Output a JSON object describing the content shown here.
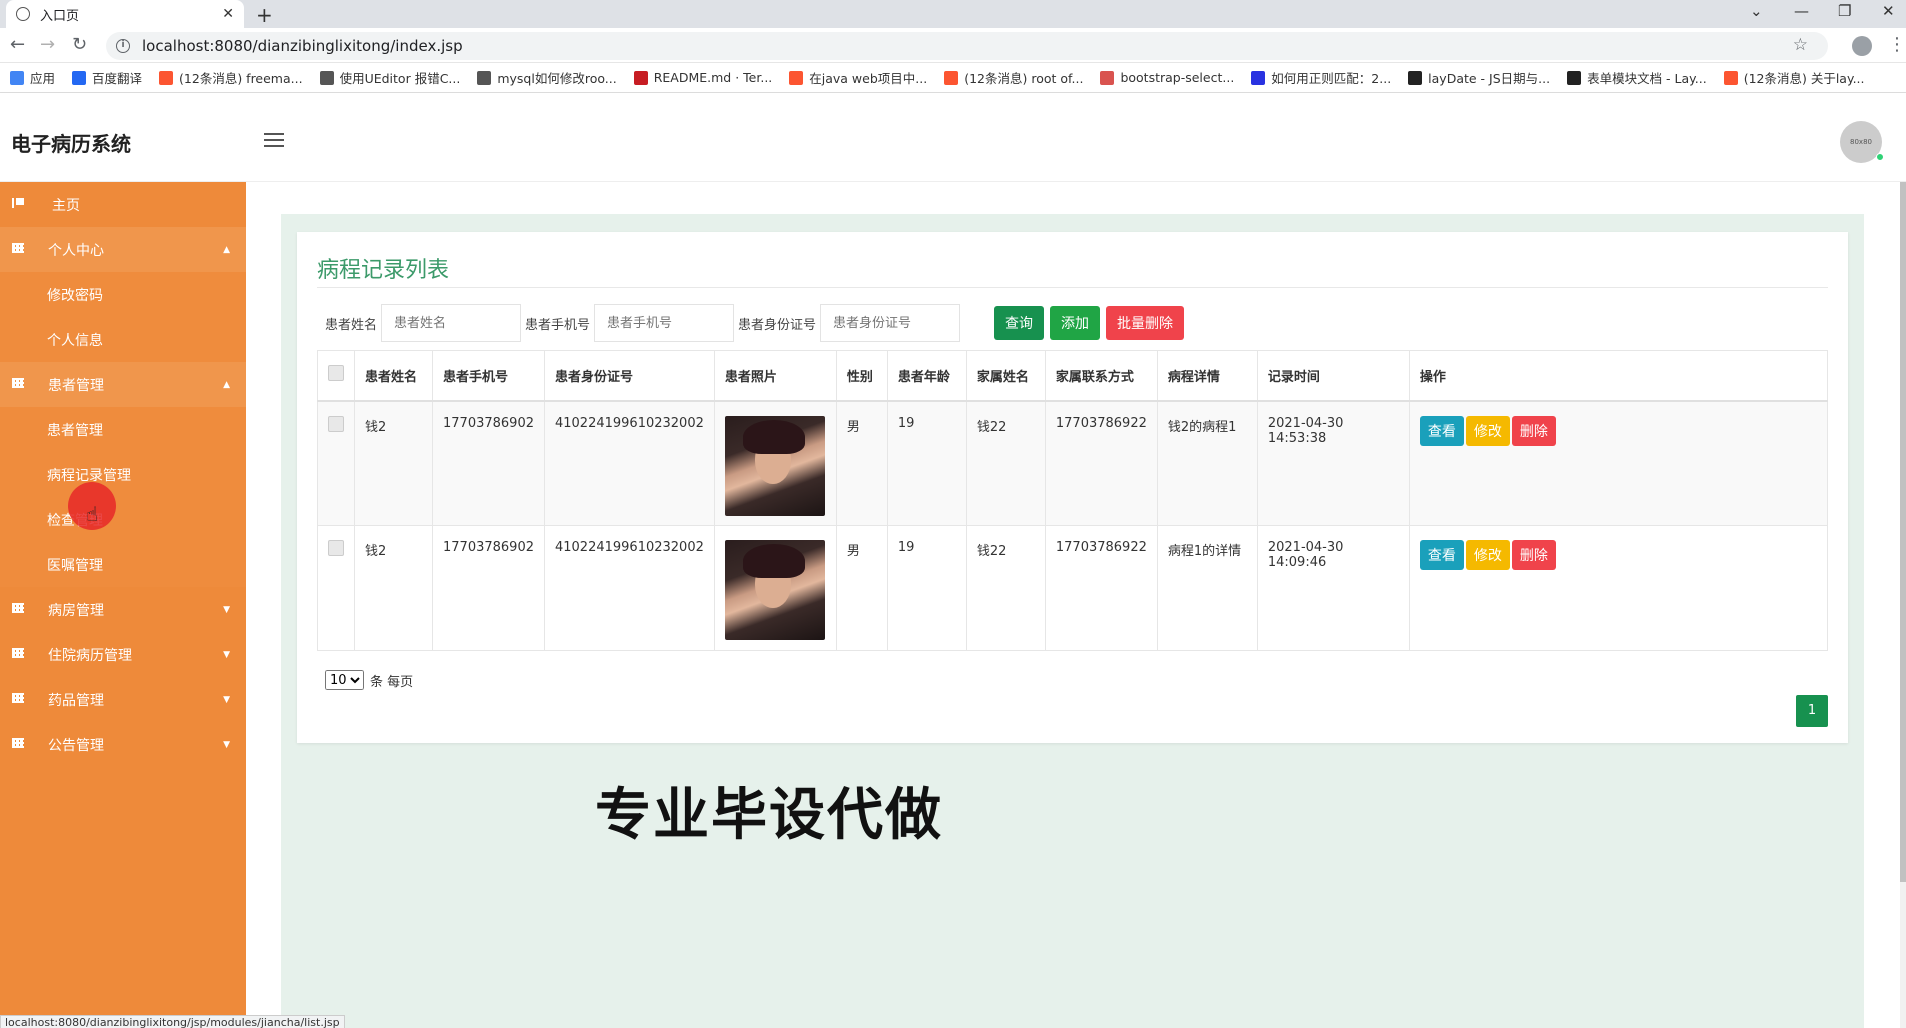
{
  "browser": {
    "tab_title": "入口页",
    "url": "localhost:8080/dianzibinglixitong/index.jsp",
    "bookmarks": [
      {
        "label": "应用",
        "color": "#4285f4"
      },
      {
        "label": "百度翻译",
        "color": "#2468f2"
      },
      {
        "label": "(12条消息) freema...",
        "color": "#fc5531"
      },
      {
        "label": "使用UEditor 报错C...",
        "color": "#555555"
      },
      {
        "label": "mysql如何修改roo...",
        "color": "#555555"
      },
      {
        "label": "README.md · Ter...",
        "color": "#c71d23"
      },
      {
        "label": "在java web项目中...",
        "color": "#fc5531"
      },
      {
        "label": "(12条消息) root of...",
        "color": "#fc5531"
      },
      {
        "label": "bootstrap-select...",
        "color": "#d9534f"
      },
      {
        "label": "如何用正则匹配：2...",
        "color": "#2932e1"
      },
      {
        "label": "layDate - JS日期与...",
        "color": "#222222"
      },
      {
        "label": "表单模块文档 - Lay...",
        "color": "#222222"
      },
      {
        "label": "(12条消息) 关于lay...",
        "color": "#fc5531"
      }
    ],
    "status_url": "localhost:8080/dianzibinglixitong/jsp/modules/jiancha/list.jsp"
  },
  "header": {
    "brand": "电子病历系统",
    "avatar_text": "80x80"
  },
  "sidebar": {
    "home": "主页",
    "personal_center": "个人中心",
    "change_password": "修改密码",
    "personal_info": "个人信息",
    "patient_mgmt": "患者管理",
    "patient_mgmt_sub": "患者管理",
    "course_record_mgmt": "病程记录管理",
    "exam_mgmt": "检查管理",
    "order_mgmt": "医嘱管理",
    "ward_mgmt": "病房管理",
    "inpatient_record_mgmt": "住院病历管理",
    "drug_mgmt": "药品管理",
    "notice_mgmt": "公告管理"
  },
  "main": {
    "title": "病程记录列表",
    "search": {
      "name_label": "患者姓名",
      "name_placeholder": "患者姓名",
      "phone_label": "患者手机号",
      "phone_placeholder": "患者手机号",
      "id_label": "患者身份证号",
      "id_placeholder": "患者身份证号",
      "query_label": "查询",
      "add_label": "添加",
      "batch_delete_label": "批量删除"
    },
    "columns": [
      "患者姓名",
      "患者手机号",
      "患者身份证号",
      "患者照片",
      "性别",
      "患者年龄",
      "家属姓名",
      "家属联系方式",
      "病程详情",
      "记录时间",
      "操作"
    ],
    "rows": [
      {
        "name": "钱2",
        "phone": "17703786902",
        "id_card": "410224199610232002",
        "gender": "男",
        "age": "19",
        "family_name": "钱22",
        "family_phone": "17703786922",
        "detail": "钱2的病程1",
        "time": "2021-04-30 14:53:38"
      },
      {
        "name": "钱2",
        "phone": "17703786902",
        "id_card": "410224199610232002",
        "gender": "男",
        "age": "19",
        "family_name": "钱22",
        "family_phone": "17703786922",
        "detail": "病程1的详情",
        "time": "2021-04-30 14:09:46"
      }
    ],
    "actions": {
      "view": "查看",
      "edit": "修改",
      "delete": "删除"
    },
    "page_size": "10",
    "page_size_suffix": "条 每页",
    "current_page": "1"
  },
  "overlay": {
    "watermark": "专业毕设代做"
  }
}
